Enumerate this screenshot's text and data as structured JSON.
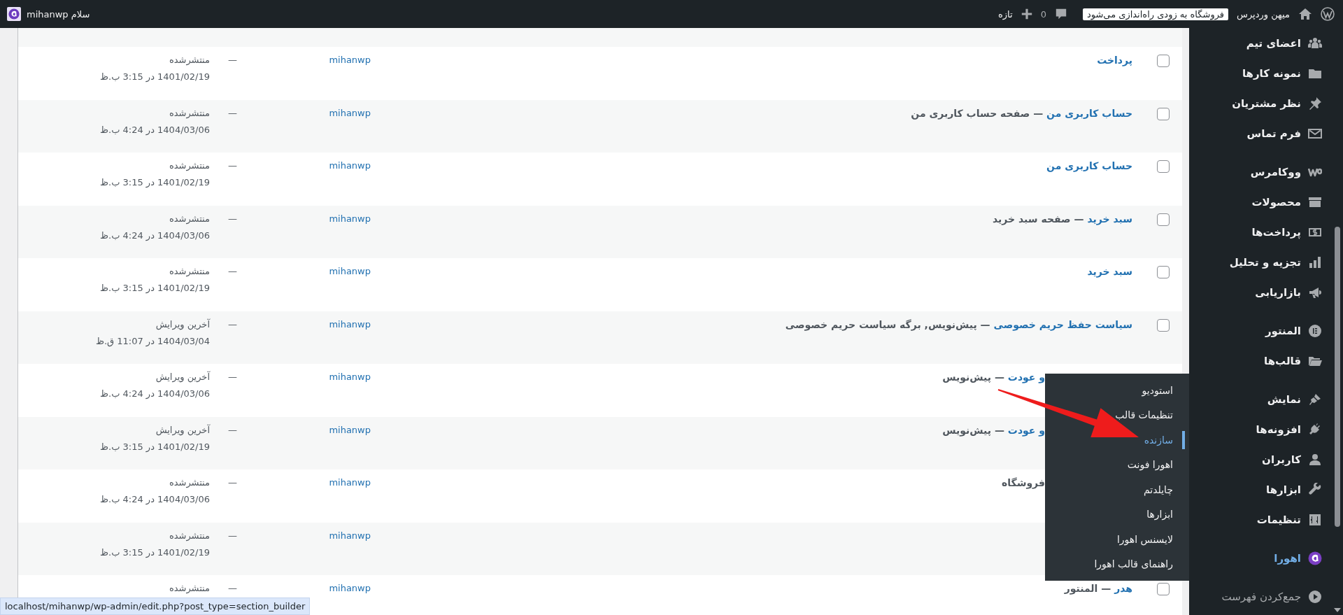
{
  "admin_bar": {
    "site_name": "میهن وردپرس",
    "notice": "فروشگاه به زودی راه‌اندازی می‌شود",
    "comments_count": "0",
    "new_label": "تازه",
    "greeting": "سلام mihanwp"
  },
  "posts": {
    "rows": [
      {
        "checked": false,
        "title": "پرداخت",
        "author": "mihanwp",
        "comments": "—",
        "status": "منتشرشده",
        "date": "1401/02/19 در 3:15 ب.ظ"
      },
      {
        "checked": false,
        "title": "حساب کاربری من",
        "suffix": "— صفحه حساب کاربری من",
        "author": "mihanwp",
        "comments": "—",
        "status": "منتشرشده",
        "date": "1404/03/06 در 4:24 ب.ظ"
      },
      {
        "checked": false,
        "title": "حساب کاربری من",
        "author": "mihanwp",
        "comments": "—",
        "status": "منتشرشده",
        "date": "1401/02/19 در 3:15 ب.ظ"
      },
      {
        "checked": false,
        "title": "سبد خرید",
        "suffix": "— صفحه سبد خرید",
        "author": "mihanwp",
        "comments": "—",
        "status": "منتشرشده",
        "date": "1404/03/06 در 4:24 ب.ظ"
      },
      {
        "checked": false,
        "title": "سبد خرید",
        "author": "mihanwp",
        "comments": "—",
        "status": "منتشرشده",
        "date": "1401/02/19 در 3:15 ب.ظ"
      },
      {
        "checked": false,
        "title": "سیاست حفظ حریم خصوصی",
        "suffix": "— پیش‌نویس, برگه سیاست حریم خصوصی",
        "author": "mihanwp",
        "comments": "—",
        "status": "آخرین ویرایش",
        "date": "1404/03/04 در 11:07 ق.ظ"
      },
      {
        "title": "و عودت",
        "suffix": "— پیش‌نویس",
        "author": "mihanwp",
        "comments": "—",
        "status": "آخرین ویرایش",
        "date": "1404/03/06 در 4:24 ب.ظ"
      },
      {
        "title": "و عودت",
        "suffix": "— پیش‌نویس",
        "author": "mihanwp",
        "comments": "—",
        "status": "آخرین ویرایش",
        "date": "1401/02/19 در 3:15 ب.ظ"
      },
      {
        "suffix": "فروشگاه",
        "author": "mihanwp",
        "comments": "—",
        "status": "منتشرشده",
        "date": "1404/03/06 در 4:24 ب.ظ"
      },
      {
        "author": "mihanwp",
        "comments": "—",
        "status": "منتشرشده",
        "date": "1401/02/19 در 3:15 ب.ظ"
      },
      {
        "checked": false,
        "title": "هدر",
        "suffix": "— المنتور",
        "author": "mihanwp",
        "comments": "—",
        "status": "منتشرشده"
      }
    ]
  },
  "sidebar": {
    "groups": [
      [
        {
          "label": "اعضای تیم",
          "selected": false
        },
        {
          "label": "نمونه کارها",
          "selected": false
        },
        {
          "label": "نظر مشتریان",
          "selected": false
        },
        {
          "label": "فرم تماس",
          "selected": false
        }
      ],
      [
        {
          "label": "ووکامرس",
          "selected": false
        },
        {
          "label": "محصولات",
          "selected": false
        },
        {
          "label": "پرداخت‌ها",
          "selected": false
        },
        {
          "label": "تجزیه و تحلیل",
          "selected": false
        },
        {
          "label": "بازاریابی",
          "selected": false
        }
      ],
      [
        {
          "label": "المنتور",
          "selected": false
        },
        {
          "label": "قالب‌ها",
          "selected": false
        }
      ],
      [
        {
          "label": "نمایش",
          "selected": false
        },
        {
          "label": "افزونه‌ها",
          "selected": false
        },
        {
          "label": "کاربران",
          "selected": false
        },
        {
          "label": "ابزارها",
          "selected": false
        },
        {
          "label": "تنظیمات",
          "selected": false
        }
      ],
      [
        {
          "label": "اهورا",
          "selected": true,
          "submenu": [
            {
              "label": "استودیو",
              "selected": false
            },
            {
              "label": "تنظیمات قالب",
              "selected": false
            },
            {
              "label": "سازنده",
              "selected": true
            },
            {
              "label": "اهورا فونت",
              "selected": false
            },
            {
              "label": "چایلدتم",
              "selected": false
            },
            {
              "label": "ابزارها",
              "selected": false
            },
            {
              "label": "لایسنس اهورا",
              "selected": false
            },
            {
              "label": "راهنمای قالب اهورا",
              "selected": false
            }
          ]
        }
      ]
    ],
    "collapse_label": "جمع‌کردن فهرست"
  },
  "status_url": "localhost/mihanwp/wp-admin/edit.php?post_type=section_builder",
  "annotation": {
    "kind": "arrow"
  }
}
